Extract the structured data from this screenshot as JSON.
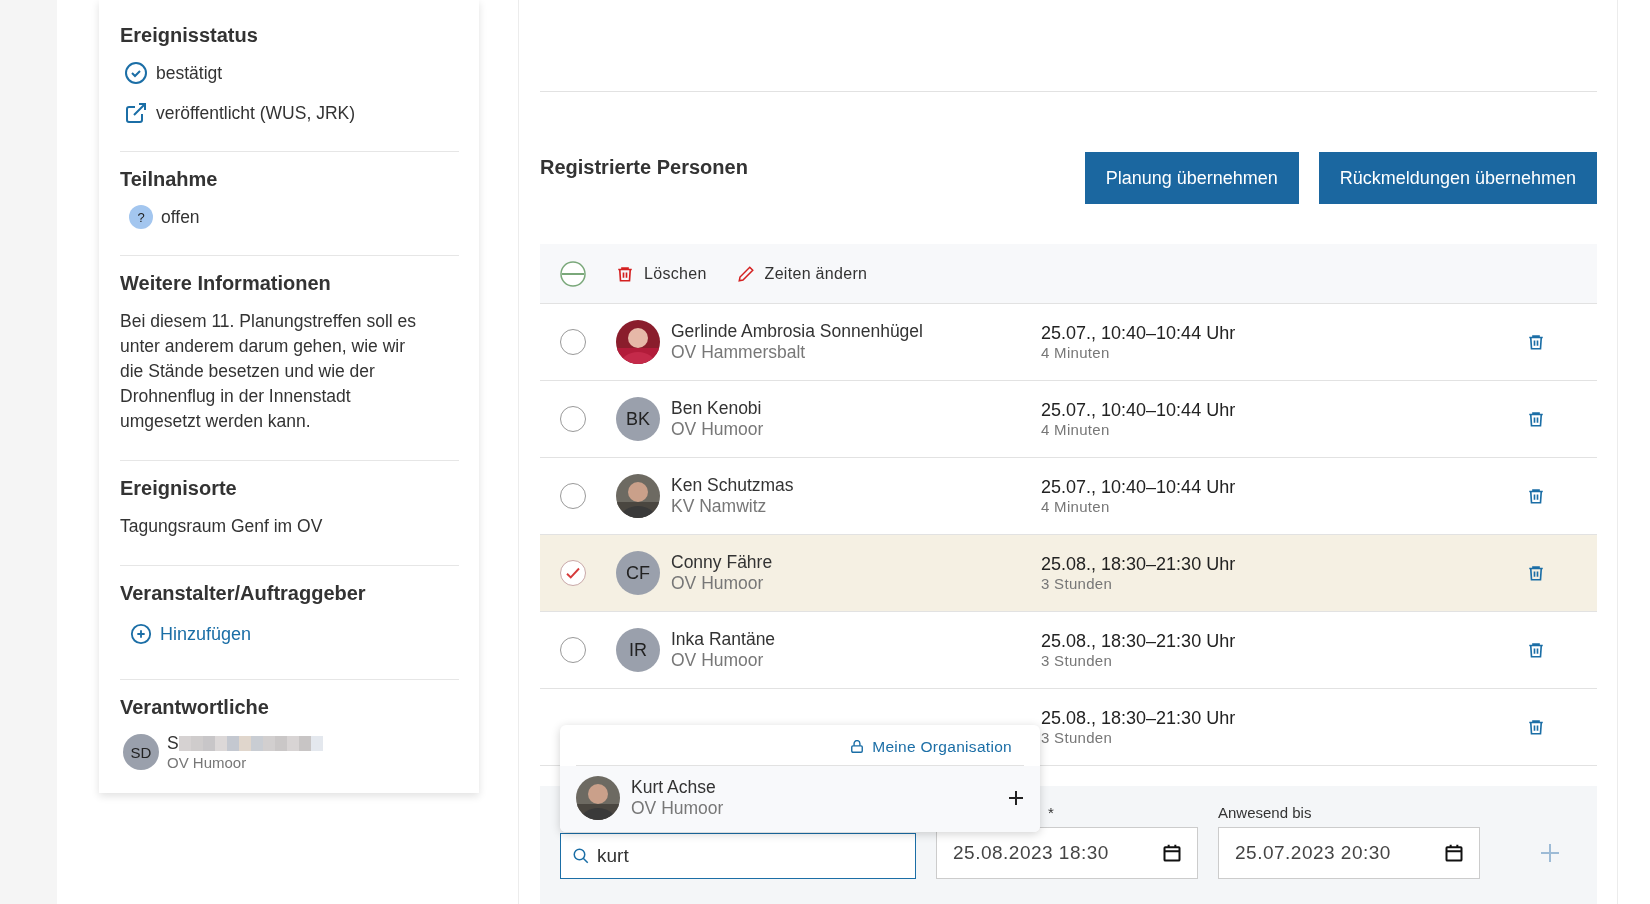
{
  "sidebar": {
    "sections": [
      {
        "title": "Ereignisstatus",
        "kind": "status",
        "items": [
          {
            "kind": "confirmed",
            "text": "bestätigt"
          },
          {
            "kind": "published",
            "text": "veröffentlicht (WUS, JRK)"
          }
        ]
      },
      {
        "title": "Teilnahme",
        "kind": "status",
        "items": [
          {
            "kind": "badge",
            "badge": "?",
            "text": "offen"
          }
        ]
      },
      {
        "title": "Weitere Informationen",
        "kind": "text",
        "text": "Bei diesem 11. Planungstreffen soll es unter anderem darum gehen, wie wir die Stände besetzen und wie der Drohnenflug in der Innenstadt umgesetzt werden kann."
      },
      {
        "title": "Ereignisorte",
        "kind": "text",
        "text": "Tagungsraum Genf im OV"
      },
      {
        "title": "Veranstalter/Auftraggeber",
        "kind": "add",
        "link": "Hinzufügen"
      },
      {
        "title": "Verantwortliche",
        "kind": "person",
        "initials": "SD",
        "name": "S",
        "org": "OV Humoor"
      }
    ]
  },
  "main": {
    "title": "Registrierte Personen",
    "buttons": [
      "Planung übernehmen",
      "Rückmeldungen übernehmen"
    ],
    "toolbar": {
      "indeterminate": true,
      "actions": [
        {
          "kind": "delete",
          "label": "Löschen"
        },
        {
          "kind": "edit",
          "label": "Zeiten ändern"
        }
      ]
    },
    "rows": [
      {
        "selected": false,
        "name": "Gerlinde Ambrosia Sonnenhügel",
        "org": "OV Hammersbalt",
        "time": "25.07., 10:40–10:44 Uhr",
        "duration": "4 Minuten"
      },
      {
        "selected": false,
        "kind": "initials",
        "initials": "BK",
        "name": "Ben Kenobi",
        "org": "OV Humoor",
        "time": "25.07., 10:40–10:44 Uhr",
        "duration": "4 Minuten"
      },
      {
        "selected": false,
        "name": "Ken Schutzmas",
        "org": "KV Namwitz",
        "time": "25.07., 10:40–10:44 Uhr",
        "duration": "4 Minuten"
      },
      {
        "selected": true,
        "kind": "initials",
        "initials": "CF",
        "name": "Conny Fähre",
        "org": "OV Humoor",
        "time": "25.08., 18:30–21:30 Uhr",
        "duration": "3 Stunden"
      },
      {
        "selected": false,
        "kind": "initials",
        "initials": "IR",
        "name": "Inka Rantäne",
        "org": "OV Humoor",
        "time": "25.08., 18:30–21:30 Uhr",
        "duration": "3 Stunden"
      },
      {
        "selected": false,
        "kind": "covered",
        "time": "25.08., 18:30–21:30 Uhr",
        "duration": "3 Stunden"
      }
    ],
    "dropdown": {
      "filter": "Meine Organisation",
      "results": [
        {
          "name": "Kurt Achse",
          "org": "OV Humoor"
        }
      ]
    },
    "add_form": {
      "search": {
        "value": "kurt"
      },
      "from": {
        "label": "*",
        "value": "25.08.2023 18:30"
      },
      "to": {
        "label": "Anwesend bis",
        "value": "25.07.2023 20:30"
      }
    }
  }
}
